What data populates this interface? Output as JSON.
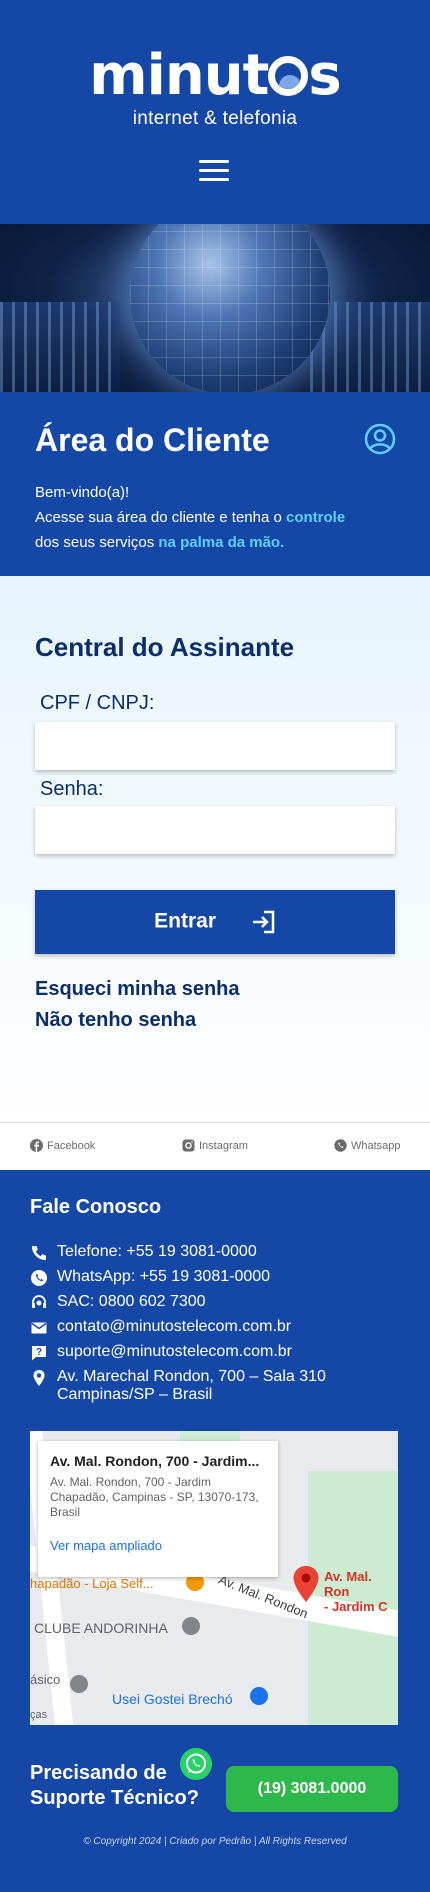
{
  "header": {
    "logo_main": "minutos",
    "logo_main_before_o": "minut",
    "logo_main_after_o": "s",
    "logo_sub": "internet & telefonia",
    "menu_icon": "hamburger-icon"
  },
  "area": {
    "title": "Área do Cliente",
    "welcome": "Bem-vindo(a)!",
    "line1_a": "Acesse sua área do cliente e tenha o ",
    "line1_b": "controle",
    "line2_a": "dos seus serviços ",
    "line2_b": "na palma da mão.",
    "user_icon": "user-circle-icon"
  },
  "login": {
    "title": "Central do Assinante",
    "cpf_label": "CPF / CNPJ:",
    "cpf_value": "",
    "senha_label": "Senha:",
    "senha_value": "",
    "entrar_label": "Entrar",
    "forgot_label": "Esqueci minha senha",
    "no_password_label": "Não tenho senha"
  },
  "social": {
    "facebook": "Facebook",
    "instagram": "Instagram",
    "whatsapp": "Whatsapp"
  },
  "fale": {
    "title": "Fale Conosco",
    "phone": "Telefone: +55 19 3081-0000",
    "whatsapp": "WhatsApp: +55 19 3081-0000",
    "sac": "SAC: 0800 602 7300",
    "email_contato": "contato@minutostelecom.com.br",
    "email_suporte": "suporte@minutostelecom.com.br",
    "address_line1": "Av. Marechal Rondon, 700 – Sala 310",
    "address_line2": "Campinas/SP – Brasil"
  },
  "map": {
    "card_title": "Av. Mal. Rondon, 700 - Jardim...",
    "card_address": "Av. Mal. Rondon, 700 - Jardim Chapadão, Campinas - SP, 13070-173, Brasil",
    "card_link": "Ver mapa ampliado",
    "pin_label_1": "Av. Mal. Ron",
    "pin_label_2": "- Jardim C",
    "street_label": "Av. Mal. Rondon",
    "poi_1": "hapadão - Loja Self...",
    "poi_2": "CLUBE ANDORINHA",
    "poi_3": "Usei Gostei Brechó",
    "poi_4": "ásico",
    "poi_5": "ças"
  },
  "support": {
    "line1": "Precisando de",
    "line2": "Suporte Técnico?",
    "phone_button": "(19) 3081.0000"
  },
  "copyright": "© Copyright 2024 | Criado por Pedrão | All Rights Reserved",
  "colors": {
    "brand_blue": "#1548a6",
    "dark_blue_text": "#0c2d6b",
    "highlight": "#5ed0ff",
    "green_button": "#2eb84b"
  }
}
